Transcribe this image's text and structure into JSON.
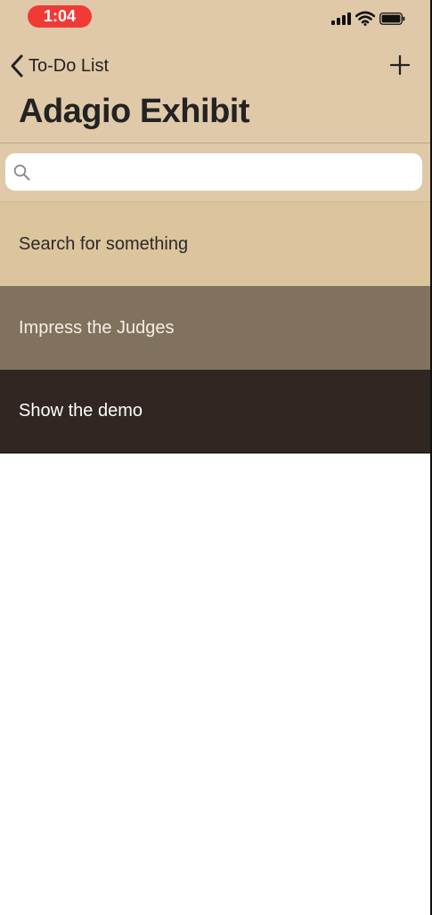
{
  "status_bar": {
    "time": "1:04",
    "icons": [
      "cellular-signal-icon",
      "wifi-icon",
      "battery-icon"
    ]
  },
  "nav": {
    "back_label": "To-Do List",
    "back_icon": "chevron-left-icon",
    "add_icon": "plus-icon",
    "title": "Adagio Exhibit"
  },
  "search": {
    "icon": "search-icon",
    "placeholder": "",
    "value": ""
  },
  "list": {
    "items": [
      {
        "label": "Search for something"
      },
      {
        "label": "Impress the Judges"
      },
      {
        "label": "Show the demo"
      }
    ]
  },
  "colors": {
    "header_bg": "#e0c9a8",
    "row_1_bg": "#dcc49d",
    "row_2_bg": "#80725c",
    "row_3_bg": "#302722",
    "time_pill": "#f13a35"
  }
}
